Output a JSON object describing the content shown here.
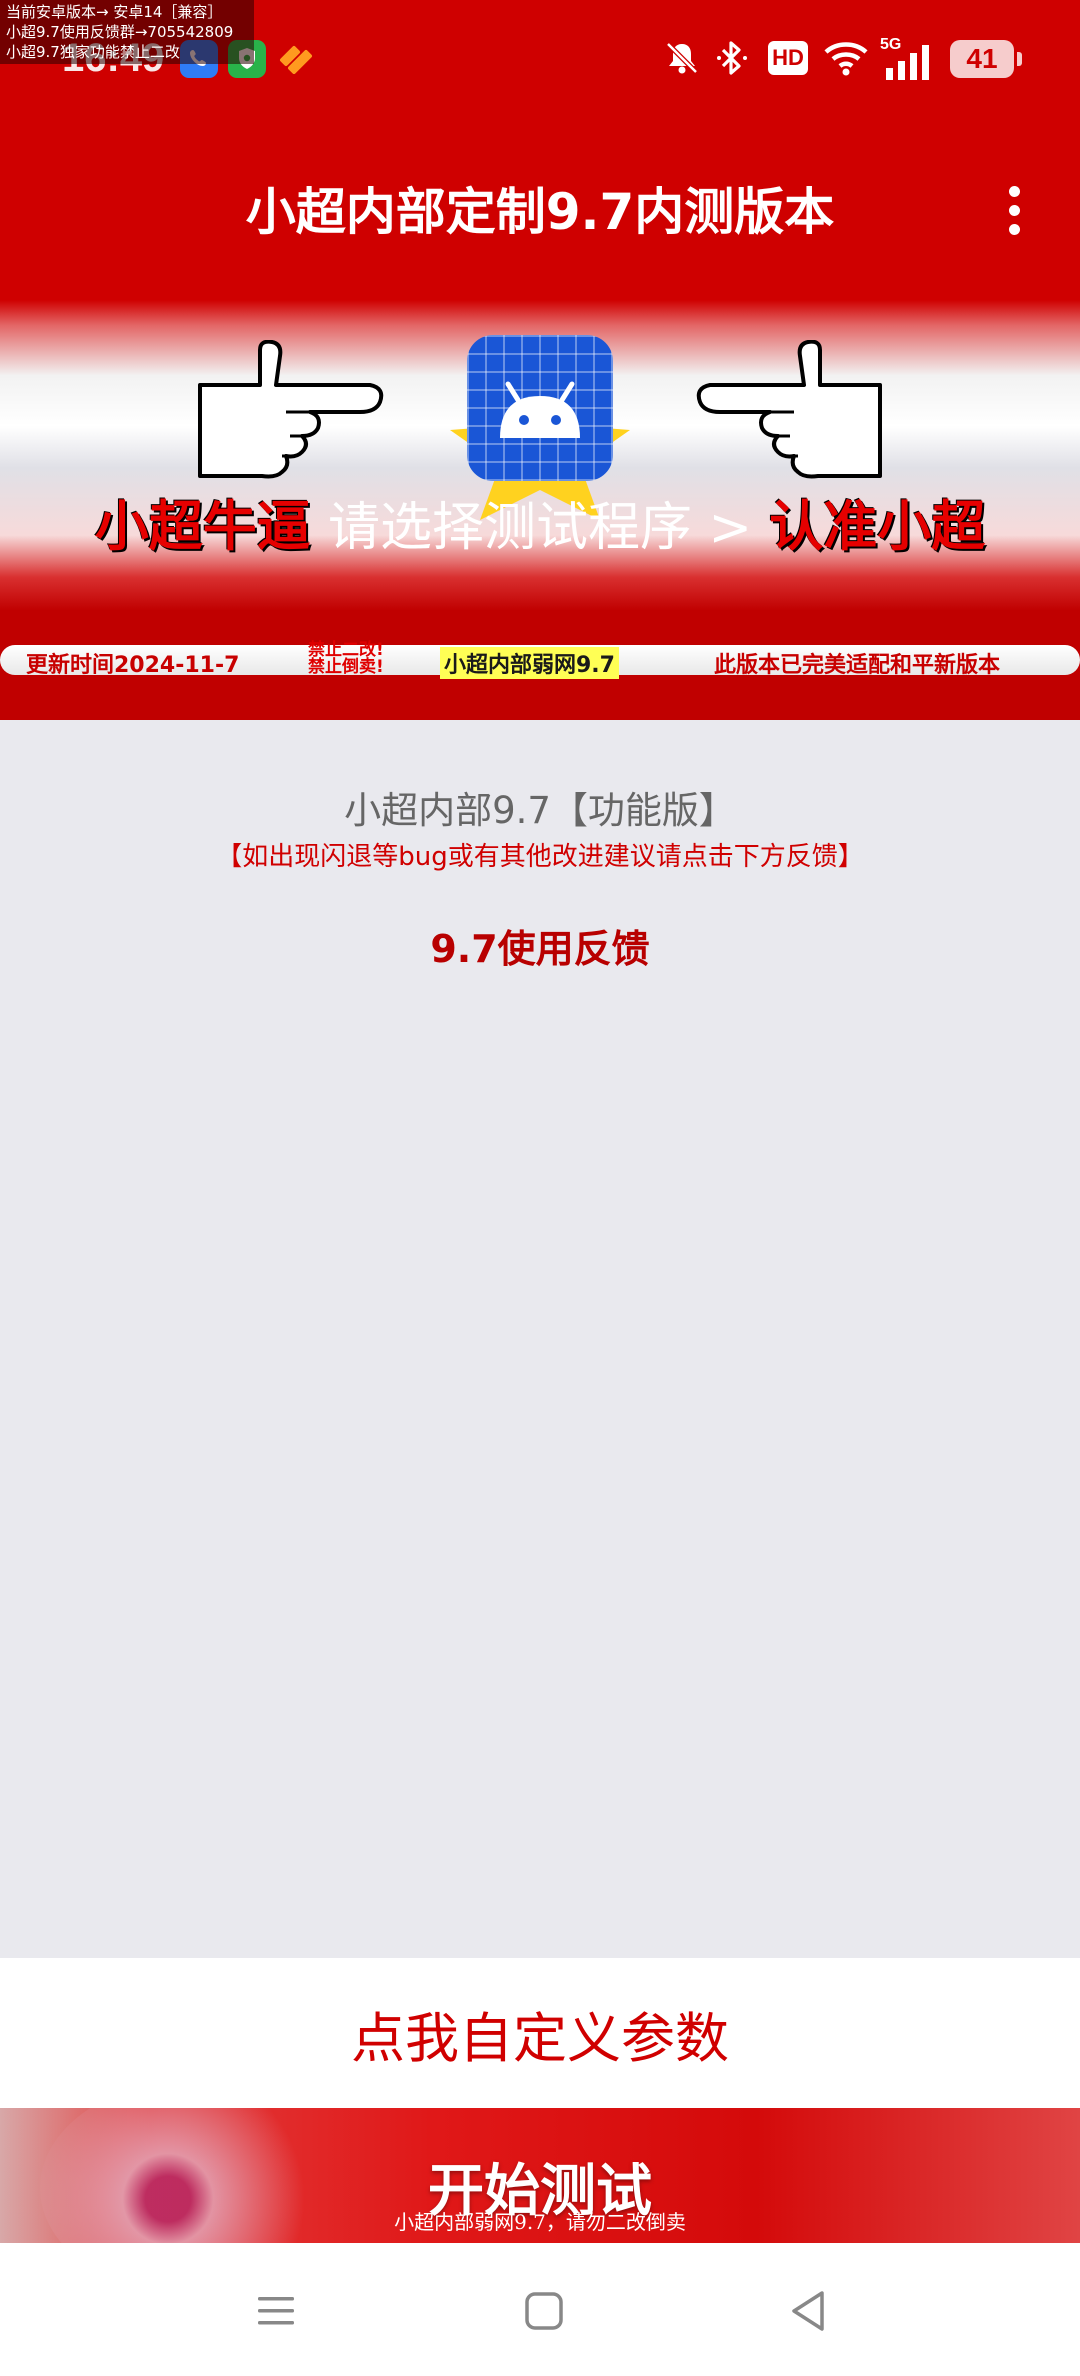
{
  "overlay_note": {
    "line1": "当前安卓版本→ 安卓14［兼容］",
    "line2": "小超9.7使用反馈群→705542809",
    "line3": "小超9.7独家功能禁止二改"
  },
  "status_bar": {
    "time": "16:49",
    "battery": "41",
    "network": "5G",
    "hd_label": "HD",
    "icons": [
      "phone-app-icon",
      "shield-app-icon",
      "orange-app-icon",
      "bell-off-icon",
      "bluetooth-icon",
      "hd-icon",
      "wifi-icon",
      "5g-signal-icon",
      "battery-icon"
    ]
  },
  "app_bar": {
    "title": "小超内部定制9.7内测版本",
    "menu_icon": "more-vert-icon"
  },
  "banner": {
    "red_left": "小超牛逼",
    "middle": "请选择测试程序 >",
    "red_right": "认准小超",
    "ticker": {
      "updated": "更新时间2024-11-7",
      "warn1": "禁止二改!",
      "warn2": "禁止倒卖!",
      "center": "小超内部弱网9.7",
      "right": "此版本已完美适配和平新版本"
    }
  },
  "content": {
    "function_title": "小超内部9.7【功能版】",
    "hint": "【如出现闪退等bug或有其他改进建议请点击下方反馈】",
    "feedback_link": "9.7使用反馈"
  },
  "buttons": {
    "custom_params": "点我自定义参数",
    "start_test": "开始测试",
    "start_sub": "小超内部弱网9.7，请勿二改倒卖"
  },
  "nav_bar": {
    "icons": [
      "menu-icon",
      "home-icon",
      "back-icon"
    ]
  },
  "colors": {
    "primary_red": "#cf0000",
    "background": "#e9e9ee",
    "accent_text_red": "#d00000"
  }
}
